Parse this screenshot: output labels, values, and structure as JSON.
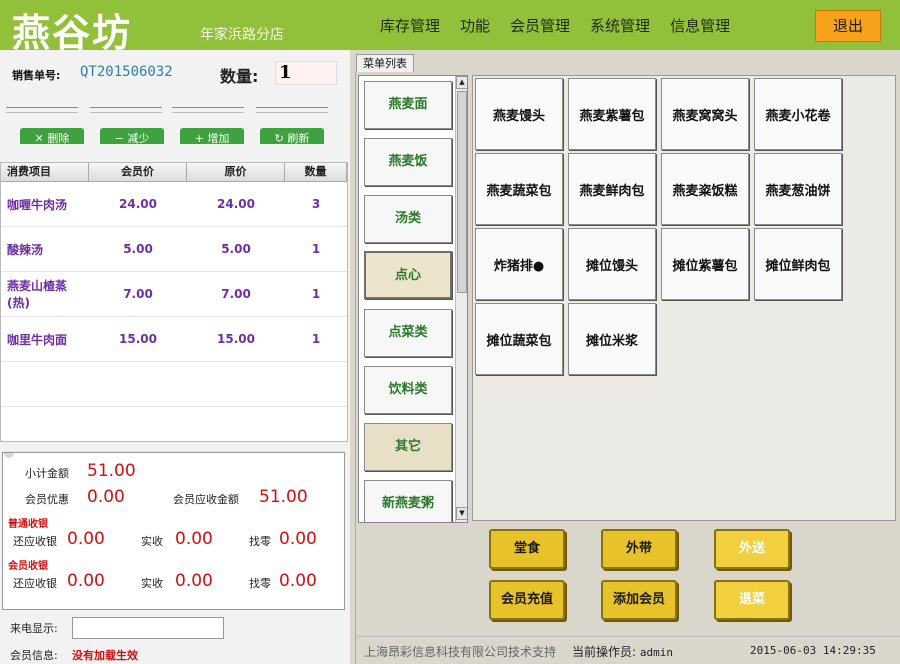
{
  "header": {
    "logo": "燕谷坊",
    "store": "年家浜路分店",
    "nav": [
      "库存管理",
      "功能",
      "会员管理",
      "系统管理",
      "信息管理"
    ],
    "exit_label": "退出",
    "bg_color": "#92c03a",
    "exit_color": "#f7a21b"
  },
  "order": {
    "label": "销售单号:",
    "number": "QT201506032",
    "qty_label": "数量:",
    "qty_value": "1"
  },
  "actions": [
    "删除",
    "减少",
    "增加",
    "刷新"
  ],
  "table": {
    "columns": [
      "消费项目",
      "会员价",
      "原价",
      "数量"
    ],
    "rows": [
      {
        "name": "咖喱牛肉汤",
        "member_price": "24.00",
        "price": "24.00",
        "qty": "3"
      },
      {
        "name": "酸辣汤",
        "member_price": "5.00",
        "price": "5.00",
        "qty": "1"
      },
      {
        "name": "燕麦山楂蒸(热)",
        "member_price": "7.00",
        "price": "7.00",
        "qty": "1"
      },
      {
        "name": "咖里牛肉面",
        "member_price": "15.00",
        "price": "15.00",
        "qty": "1"
      }
    ]
  },
  "summary": {
    "subtotal_label": "小计金额",
    "subtotal": "51.00",
    "member_discount_label": "会员优惠",
    "member_discount": "0.00",
    "member_due_label": "会员应收金额",
    "member_due": "51.00",
    "regular_section": "普通收银",
    "member_section": "会员收银",
    "due_label": "还应收银",
    "paid_label": "实收",
    "change_label": "找零",
    "regular": {
      "due": "0.00",
      "paid": "0.00",
      "change": "0.00"
    },
    "member": {
      "due": "0.00",
      "paid": "0.00",
      "change": "0.00"
    }
  },
  "caller": {
    "label": "来电显示:",
    "value": ""
  },
  "member_info": {
    "label": "会员信息:",
    "value": "没有加载生效"
  },
  "menu_tab": "菜单列表",
  "categories": [
    "燕麦面",
    "燕麦饭",
    "汤类",
    "点心",
    "点菜类",
    "饮料类",
    "其它",
    "新燕麦粥"
  ],
  "selected_category": "点心",
  "items": [
    "燕麦馒头",
    "燕麦紫薯包",
    "燕麦窝窝头",
    "燕麦小花卷",
    "燕麦蔬菜包",
    "燕麦鲜肉包",
    "燕麦粢饭糕",
    "燕麦葱油饼",
    "炸猪排●",
    "摊位馒头",
    "摊位紫薯包",
    "摊位鲜肉包",
    "摊位蔬菜包",
    "摊位米浆"
  ],
  "bottom_buttons": [
    "堂食",
    "外带",
    "外送",
    "会员充值",
    "添加会员",
    "退菜"
  ],
  "status": {
    "company": "上海昂彩信息科技有限公司技术支持",
    "operator_label": "当前操作员:",
    "operator": "admin",
    "datetime": "2015-06-03 14:29:35"
  }
}
